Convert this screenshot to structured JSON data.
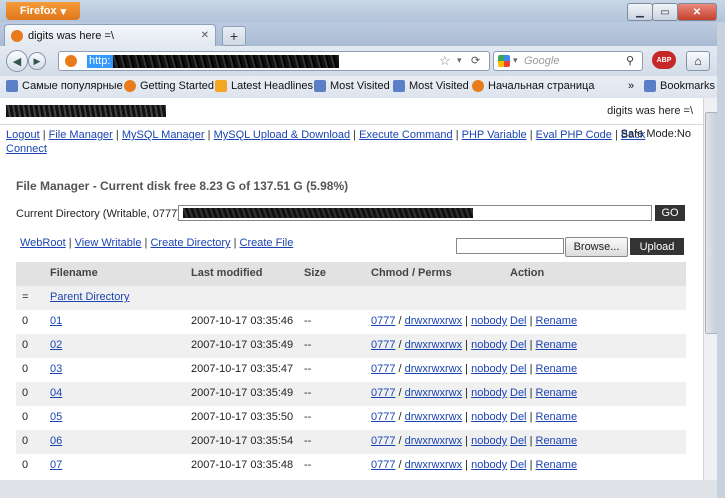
{
  "browser": {
    "app_button": "Firefox",
    "tab_title": "digits was here =\\",
    "url_prefix": "http:",
    "search_placeholder": "Google",
    "bookmarks": [
      {
        "label": "Самые популярные"
      },
      {
        "label": "Getting Started"
      },
      {
        "label": "Latest Headlines"
      },
      {
        "label": "Most Visited"
      },
      {
        "label": "Most Visited"
      },
      {
        "label": "Начальная страница"
      }
    ],
    "bookmarks_menu": "Bookmarks",
    "overflow": "»"
  },
  "page": {
    "header_title": "digits was here =\\",
    "menu": [
      "Logout",
      "File Manager",
      "MySQL Manager",
      "MySQL Upload & Download",
      "Execute Command",
      "PHP Variable",
      "Eval PHP Code",
      "Back",
      "Connect"
    ],
    "safe_mode": "Safe Mode:No",
    "fm_title": "File Manager - Current disk free 8.23 G of 137.51 G (5.98%)",
    "current_dir_label": "Current Directory (Writable, 0777)",
    "go_label": "GO",
    "tools": [
      "WebRoot",
      "View Writable",
      "Create Directory",
      "Create File"
    ],
    "browse_label": "Browse...",
    "upload_label": "Upload",
    "columns": [
      "Filename",
      "Last modified",
      "Size",
      "Chmod / Perms",
      "Action"
    ],
    "parent_marker": "=",
    "parent_label": "Parent Directory",
    "files": [
      {
        "mark": "0",
        "name": "01",
        "modified": "2007-10-17 03:35:46",
        "size": "--",
        "chmod": "0777",
        "perms": "drwxrwxrwx",
        "owner": "nobody",
        "del": "Del",
        "rename": "Rename"
      },
      {
        "mark": "0",
        "name": "02",
        "modified": "2007-10-17 03:35:49",
        "size": "--",
        "chmod": "0777",
        "perms": "drwxrwxrwx",
        "owner": "nobody",
        "del": "Del",
        "rename": "Rename"
      },
      {
        "mark": "0",
        "name": "03",
        "modified": "2007-10-17 03:35:47",
        "size": "--",
        "chmod": "0777",
        "perms": "drwxrwxrwx",
        "owner": "nobody",
        "del": "Del",
        "rename": "Rename"
      },
      {
        "mark": "0",
        "name": "04",
        "modified": "2007-10-17 03:35:49",
        "size": "--",
        "chmod": "0777",
        "perms": "drwxrwxrwx",
        "owner": "nobody",
        "del": "Del",
        "rename": "Rename"
      },
      {
        "mark": "0",
        "name": "05",
        "modified": "2007-10-17 03:35:50",
        "size": "--",
        "chmod": "0777",
        "perms": "drwxrwxrwx",
        "owner": "nobody",
        "del": "Del",
        "rename": "Rename"
      },
      {
        "mark": "0",
        "name": "06",
        "modified": "2007-10-17 03:35:54",
        "size": "--",
        "chmod": "0777",
        "perms": "drwxrwxrwx",
        "owner": "nobody",
        "del": "Del",
        "rename": "Rename"
      },
      {
        "mark": "0",
        "name": "07",
        "modified": "2007-10-17 03:35:48",
        "size": "--",
        "chmod": "0777",
        "perms": "drwxrwxrwx",
        "owner": "nobody",
        "del": "Del",
        "rename": "Rename"
      }
    ]
  }
}
